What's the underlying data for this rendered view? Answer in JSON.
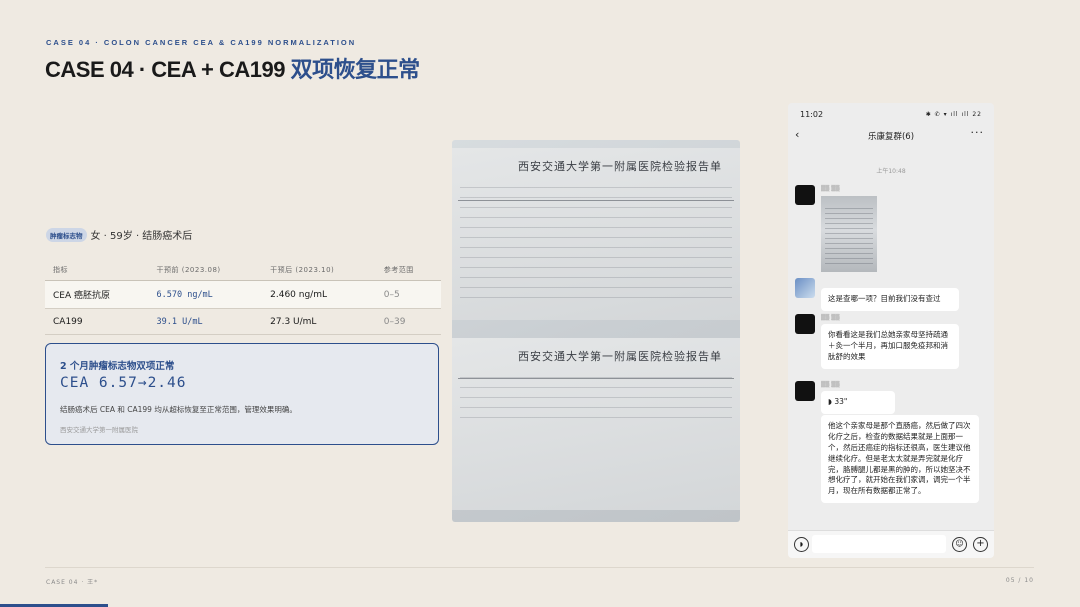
{
  "header": {
    "eyebrow": "CASE 04 · COLON CANCER CEA & CA199 NORMALIZATION",
    "title_main": "CASE 04 · CEA + CA199",
    "title_accent": "双项恢复正常"
  },
  "subject": {
    "tag": "肿瘤标志物",
    "text": "女 · 59岁 · 结肠癌术后"
  },
  "table": {
    "headers": [
      "指标",
      "干预前 (2023.08)",
      "干预后 (2023.10)",
      "参考范围"
    ],
    "rows": [
      {
        "name": "CEA 癌胚抗原",
        "before": "6.570 ng/mL",
        "after": "2.460 ng/mL",
        "ref": "0–5"
      },
      {
        "name": "CA199",
        "before": "39.1 U/mL",
        "after": "27.3 U/mL",
        "ref": "0–39"
      }
    ]
  },
  "card": {
    "headline": "2 个月肿瘤标志物双项正常",
    "metric": "CEA 6.57→2.46",
    "body": "结肠癌术后 CEA 和 CA199 均从超标恢复至正常范围，管理效果明确。",
    "source": "西安交通大学第一附属医院"
  },
  "report_photo": {
    "title_top": "西安交通大学第一附属医院检验报告单",
    "title_bottom": "西安交通大学第一附属医院检验报告单"
  },
  "phone": {
    "time": "11:02",
    "status_right": "✱ ✆ ▾ ıll ıll 22",
    "chat_title": "乐康复群(6)",
    "timestamp": "上午10:48",
    "messages": [
      {
        "text": "这是查哪一项？目前我们没有查过"
      },
      {
        "text": "你看看这是我们总她亲家母坚持疏通＋灸一个半月，再加口服免疫邦和消肽舒的效果"
      },
      {
        "text": "33\""
      },
      {
        "text": "他这个亲家母是那个直肠癌，然后做了四次化疗之后，检查的数据结果就是上面那一个，然后还癌症的指标还很高，医生建议他继续化疗。但是老太太就是弄完就是化疗完，胳膊腿儿都是黑的肿的，所以她坚决不想化疗了，就开始在我们家调，调完一个半月，现在所有数据都正常了。"
      }
    ]
  },
  "footer": {
    "left": "CASE 04 · 王*",
    "right": "05 / 10"
  },
  "colors": {
    "accent": "#2d4f8c",
    "background": "#efeae2"
  }
}
